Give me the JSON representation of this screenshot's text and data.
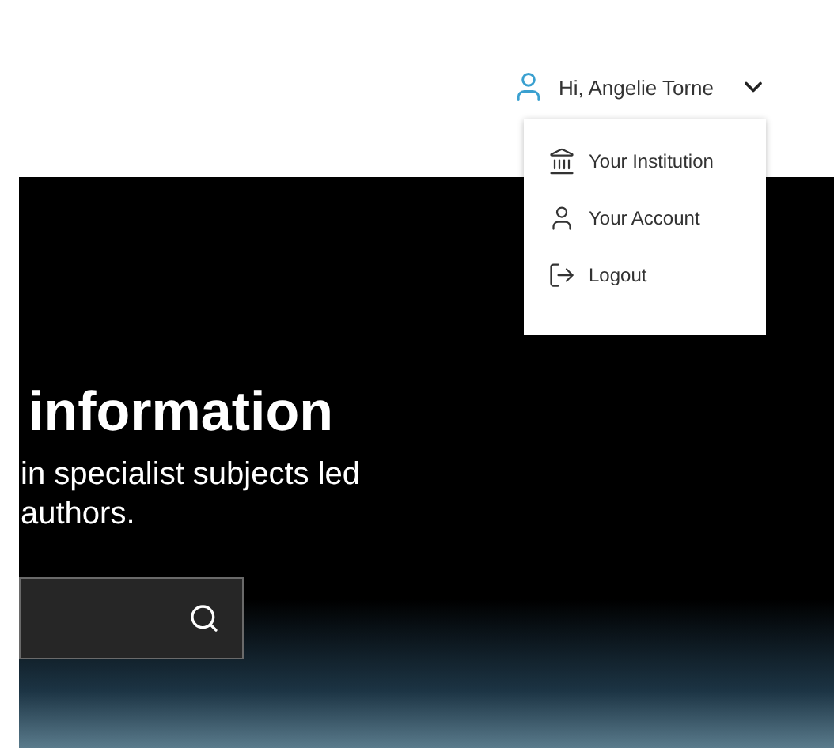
{
  "user_menu": {
    "greeting": "Hi, Angelie Torne",
    "expanded": true,
    "items": [
      {
        "kind": "institution",
        "label": "Your Institution"
      },
      {
        "kind": "account",
        "label": "Your Account"
      },
      {
        "kind": "logout",
        "label": "Logout"
      }
    ]
  },
  "hero": {
    "heading": "information",
    "subtitle_lines": [
      "in specialist subjects led",
      "authors."
    ]
  }
}
